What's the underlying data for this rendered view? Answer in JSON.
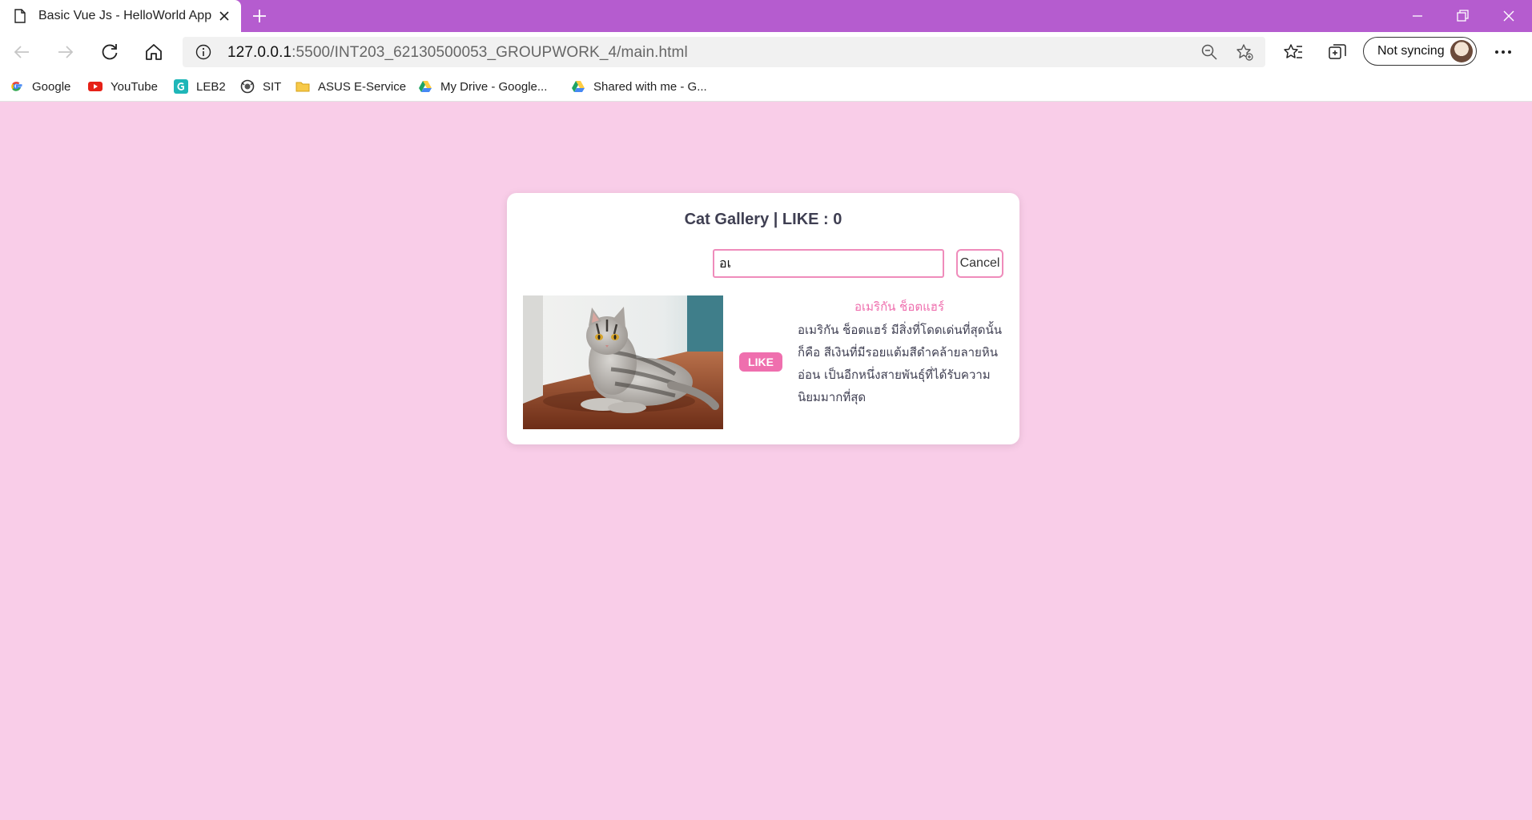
{
  "browser": {
    "tab_title": "Basic Vue Js - HelloWorld App",
    "url_host": "127.0.0.1",
    "url_path": ":5500/INT203_62130500053_GROUPWORK_4/main.html",
    "sync_label": "Not syncing",
    "bookmarks": [
      {
        "label": "Google",
        "icon": "google-icon"
      },
      {
        "label": "YouTube",
        "icon": "youtube-icon"
      },
      {
        "label": "LEB2",
        "icon": "leb2-icon"
      },
      {
        "label": "SIT",
        "icon": "sit-icon"
      },
      {
        "label": "ASUS E-Service",
        "icon": "folder-icon"
      },
      {
        "label": "My Drive - Google...",
        "icon": "google-drive-icon"
      },
      {
        "label": "Shared with me - G...",
        "icon": "google-drive-icon"
      }
    ],
    "colors": {
      "titlebar": "#b55ccf",
      "page_bg": "#f9cde8"
    }
  },
  "gallery": {
    "title": "Cat Gallery | LIKE : 0",
    "search_value": "อเ",
    "cancel_label": "Cancel",
    "like_label": "LIKE",
    "accent": "#ef6fae",
    "cat": {
      "name": "อเมริกัน ช็อตแฮร์",
      "description": "อเมริกัน ช็อตแฮร์ มีสิ่งที่โดดเด่นที่สุดนั้นก็คือ สีเงินที่มีรอยแต้มสีดำคล้ายลายหินอ่อน เป็นอีกหนึ่งสายพันธุ์ที่ได้รับความนิยมมากที่สุด",
      "image": "american-shorthair-cat-photo"
    }
  }
}
